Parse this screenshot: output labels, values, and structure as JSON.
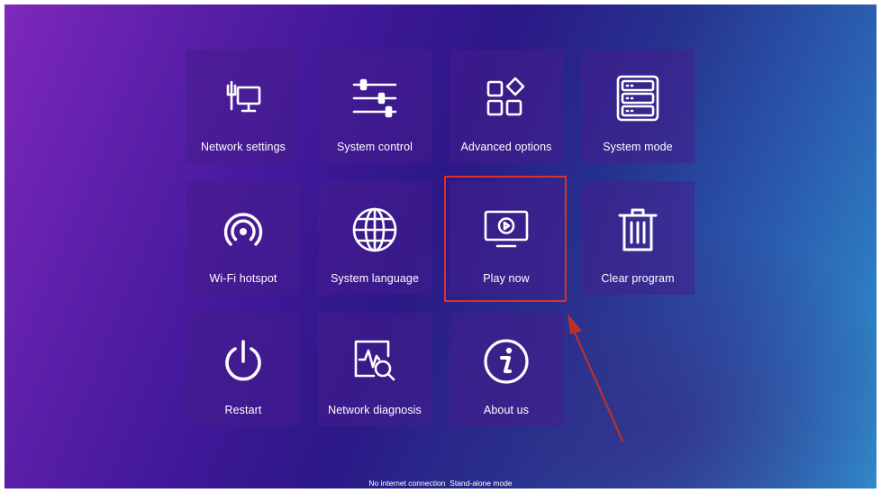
{
  "tiles": [
    {
      "label": "Network settings",
      "icon": "network-settings-icon"
    },
    {
      "label": "System control",
      "icon": "sliders-icon"
    },
    {
      "label": "Advanced options",
      "icon": "apps-grid-icon"
    },
    {
      "label": "System mode",
      "icon": "server-icon"
    },
    {
      "label": "Wi-Fi hotspot",
      "icon": "hotspot-icon"
    },
    {
      "label": "System language",
      "icon": "globe-icon"
    },
    {
      "label": "Play now",
      "icon": "play-monitor-icon"
    },
    {
      "label": "Clear program",
      "icon": "trash-icon"
    },
    {
      "label": "Restart",
      "icon": "power-icon"
    },
    {
      "label": "Network diagnosis",
      "icon": "diagnosis-icon"
    },
    {
      "label": "About us",
      "icon": "info-icon"
    }
  ],
  "focused_tile": "Play now",
  "annotation": {
    "type": "arrow",
    "color": "#c0392b"
  },
  "status_bar": {
    "connection": "No internet connection",
    "mode": "Stand-alone mode"
  },
  "colors": {
    "tile_background": "#4a1e8c",
    "focus_border": "#d9302a",
    "text": "#ffffff"
  }
}
